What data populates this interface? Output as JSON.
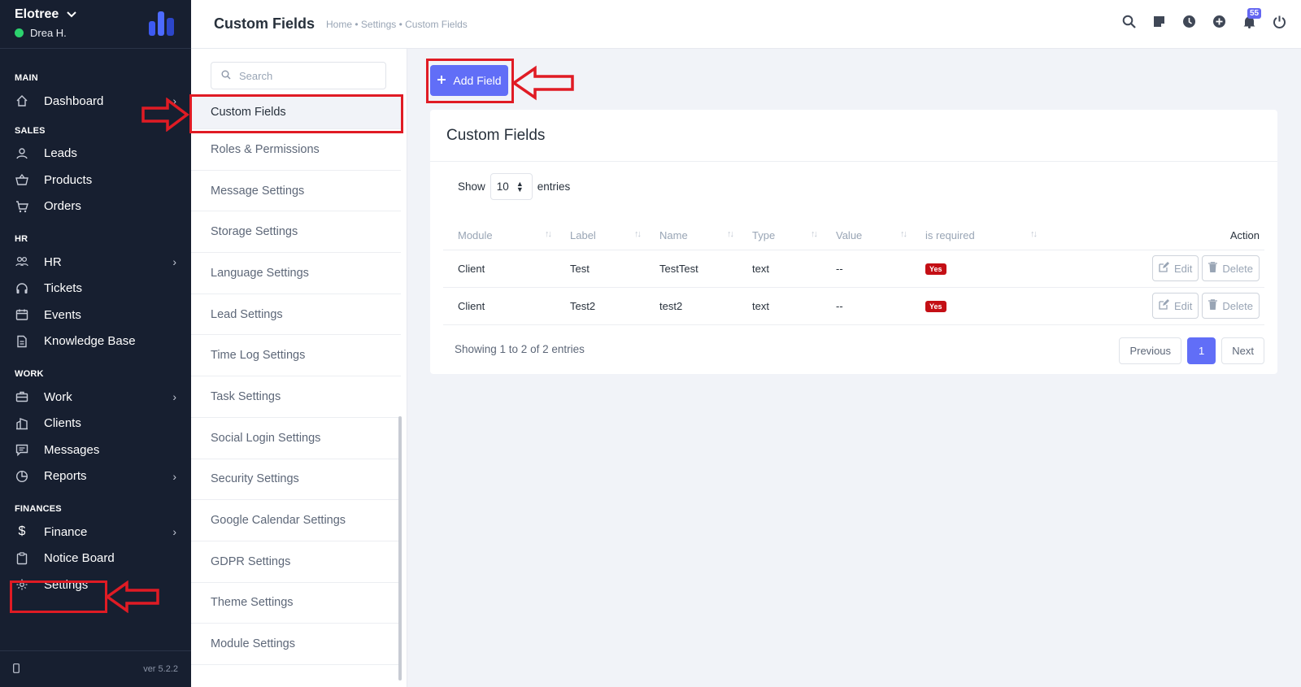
{
  "brand": {
    "name": "Elotree",
    "user": "Drea H."
  },
  "sidebar": {
    "sections": [
      {
        "title": "MAIN",
        "items": [
          {
            "label": "Dashboard",
            "icon": "house-icon",
            "chevron": true
          }
        ]
      },
      {
        "title": "SALES",
        "items": [
          {
            "label": "Leads",
            "icon": "person-icon"
          },
          {
            "label": "Products",
            "icon": "basket-icon"
          },
          {
            "label": "Orders",
            "icon": "cart-icon"
          }
        ]
      },
      {
        "title": "HR",
        "items": [
          {
            "label": "HR",
            "icon": "people-icon",
            "chevron": true
          },
          {
            "label": "Tickets",
            "icon": "headset-icon"
          },
          {
            "label": "Events",
            "icon": "calendar-icon"
          },
          {
            "label": "Knowledge Base",
            "icon": "document-icon"
          }
        ]
      },
      {
        "title": "WORK",
        "items": [
          {
            "label": "Work",
            "icon": "briefcase-icon",
            "chevron": true
          },
          {
            "label": "Clients",
            "icon": "building-icon"
          },
          {
            "label": "Messages",
            "icon": "chat-icon"
          },
          {
            "label": "Reports",
            "icon": "pie-chart-icon",
            "chevron": true
          }
        ]
      },
      {
        "title": "FINANCES",
        "items": [
          {
            "label": "Finance",
            "icon": "dollar-icon",
            "chevron": true
          },
          {
            "label": "Notice Board",
            "icon": "clipboard-icon"
          },
          {
            "label": "Settings",
            "icon": "gear-icon"
          }
        ]
      }
    ],
    "version": "ver 5.2.2"
  },
  "header": {
    "title": "Custom Fields",
    "breadcrumb": "Home • Settings • Custom Fields",
    "notification_count": "55"
  },
  "settings_menu": {
    "search_placeholder": "Search",
    "items": [
      "Custom Fields",
      "Roles & Permissions",
      "Message Settings",
      "Storage Settings",
      "Language Settings",
      "Lead Settings",
      "Time Log Settings",
      "Task Settings",
      "Social Login Settings",
      "Security Settings",
      "Google Calendar Settings",
      "GDPR Settings",
      "Theme Settings",
      "Module Settings"
    ]
  },
  "main": {
    "add_button": "Add Field",
    "card_title": "Custom Fields",
    "show_label": "Show",
    "entries_value": "10",
    "entries_label": "entries",
    "columns": [
      "Module",
      "Label",
      "Name",
      "Type",
      "Value",
      "is required",
      "Action"
    ],
    "rows": [
      {
        "module": "Client",
        "label": "Test",
        "name": "TestTest",
        "type": "text",
        "value": "--",
        "required": "Yes"
      },
      {
        "module": "Client",
        "label": "Test2",
        "name": "test2",
        "type": "text",
        "value": "--",
        "required": "Yes"
      }
    ],
    "edit_label": "Edit",
    "delete_label": "Delete",
    "showing_text": "Showing 1 to 2 of 2 entries",
    "pagination": {
      "previous": "Previous",
      "current": "1",
      "next": "Next"
    }
  },
  "colors": {
    "sidebar": "#171f30",
    "accent": "#616ef7",
    "annotation": "#e01b24",
    "required_badge": "#c40f15"
  }
}
